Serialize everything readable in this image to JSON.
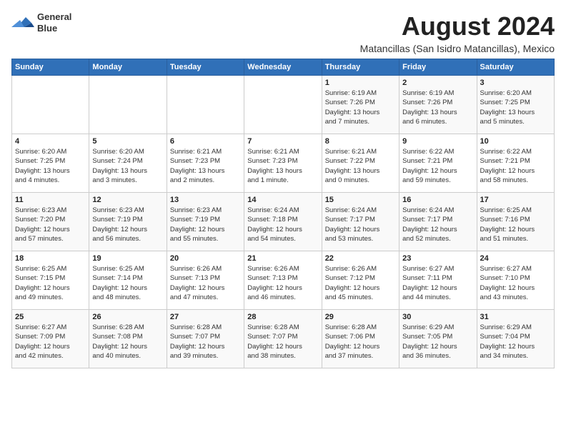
{
  "logo": {
    "line1": "General",
    "line2": "Blue"
  },
  "title": "August 2024",
  "subtitle": "Matancillas (San Isidro Matancillas), Mexico",
  "days_of_week": [
    "Sunday",
    "Monday",
    "Tuesday",
    "Wednesday",
    "Thursday",
    "Friday",
    "Saturday"
  ],
  "weeks": [
    [
      {
        "day": "",
        "info": ""
      },
      {
        "day": "",
        "info": ""
      },
      {
        "day": "",
        "info": ""
      },
      {
        "day": "",
        "info": ""
      },
      {
        "day": "1",
        "info": "Sunrise: 6:19 AM\nSunset: 7:26 PM\nDaylight: 13 hours\nand 7 minutes."
      },
      {
        "day": "2",
        "info": "Sunrise: 6:19 AM\nSunset: 7:26 PM\nDaylight: 13 hours\nand 6 minutes."
      },
      {
        "day": "3",
        "info": "Sunrise: 6:20 AM\nSunset: 7:25 PM\nDaylight: 13 hours\nand 5 minutes."
      }
    ],
    [
      {
        "day": "4",
        "info": "Sunrise: 6:20 AM\nSunset: 7:25 PM\nDaylight: 13 hours\nand 4 minutes."
      },
      {
        "day": "5",
        "info": "Sunrise: 6:20 AM\nSunset: 7:24 PM\nDaylight: 13 hours\nand 3 minutes."
      },
      {
        "day": "6",
        "info": "Sunrise: 6:21 AM\nSunset: 7:23 PM\nDaylight: 13 hours\nand 2 minutes."
      },
      {
        "day": "7",
        "info": "Sunrise: 6:21 AM\nSunset: 7:23 PM\nDaylight: 13 hours\nand 1 minute."
      },
      {
        "day": "8",
        "info": "Sunrise: 6:21 AM\nSunset: 7:22 PM\nDaylight: 13 hours\nand 0 minutes."
      },
      {
        "day": "9",
        "info": "Sunrise: 6:22 AM\nSunset: 7:21 PM\nDaylight: 12 hours\nand 59 minutes."
      },
      {
        "day": "10",
        "info": "Sunrise: 6:22 AM\nSunset: 7:21 PM\nDaylight: 12 hours\nand 58 minutes."
      }
    ],
    [
      {
        "day": "11",
        "info": "Sunrise: 6:23 AM\nSunset: 7:20 PM\nDaylight: 12 hours\nand 57 minutes."
      },
      {
        "day": "12",
        "info": "Sunrise: 6:23 AM\nSunset: 7:19 PM\nDaylight: 12 hours\nand 56 minutes."
      },
      {
        "day": "13",
        "info": "Sunrise: 6:23 AM\nSunset: 7:19 PM\nDaylight: 12 hours\nand 55 minutes."
      },
      {
        "day": "14",
        "info": "Sunrise: 6:24 AM\nSunset: 7:18 PM\nDaylight: 12 hours\nand 54 minutes."
      },
      {
        "day": "15",
        "info": "Sunrise: 6:24 AM\nSunset: 7:17 PM\nDaylight: 12 hours\nand 53 minutes."
      },
      {
        "day": "16",
        "info": "Sunrise: 6:24 AM\nSunset: 7:17 PM\nDaylight: 12 hours\nand 52 minutes."
      },
      {
        "day": "17",
        "info": "Sunrise: 6:25 AM\nSunset: 7:16 PM\nDaylight: 12 hours\nand 51 minutes."
      }
    ],
    [
      {
        "day": "18",
        "info": "Sunrise: 6:25 AM\nSunset: 7:15 PM\nDaylight: 12 hours\nand 49 minutes."
      },
      {
        "day": "19",
        "info": "Sunrise: 6:25 AM\nSunset: 7:14 PM\nDaylight: 12 hours\nand 48 minutes."
      },
      {
        "day": "20",
        "info": "Sunrise: 6:26 AM\nSunset: 7:13 PM\nDaylight: 12 hours\nand 47 minutes."
      },
      {
        "day": "21",
        "info": "Sunrise: 6:26 AM\nSunset: 7:13 PM\nDaylight: 12 hours\nand 46 minutes."
      },
      {
        "day": "22",
        "info": "Sunrise: 6:26 AM\nSunset: 7:12 PM\nDaylight: 12 hours\nand 45 minutes."
      },
      {
        "day": "23",
        "info": "Sunrise: 6:27 AM\nSunset: 7:11 PM\nDaylight: 12 hours\nand 44 minutes."
      },
      {
        "day": "24",
        "info": "Sunrise: 6:27 AM\nSunset: 7:10 PM\nDaylight: 12 hours\nand 43 minutes."
      }
    ],
    [
      {
        "day": "25",
        "info": "Sunrise: 6:27 AM\nSunset: 7:09 PM\nDaylight: 12 hours\nand 42 minutes."
      },
      {
        "day": "26",
        "info": "Sunrise: 6:28 AM\nSunset: 7:08 PM\nDaylight: 12 hours\nand 40 minutes."
      },
      {
        "day": "27",
        "info": "Sunrise: 6:28 AM\nSunset: 7:07 PM\nDaylight: 12 hours\nand 39 minutes."
      },
      {
        "day": "28",
        "info": "Sunrise: 6:28 AM\nSunset: 7:07 PM\nDaylight: 12 hours\nand 38 minutes."
      },
      {
        "day": "29",
        "info": "Sunrise: 6:28 AM\nSunset: 7:06 PM\nDaylight: 12 hours\nand 37 minutes."
      },
      {
        "day": "30",
        "info": "Sunrise: 6:29 AM\nSunset: 7:05 PM\nDaylight: 12 hours\nand 36 minutes."
      },
      {
        "day": "31",
        "info": "Sunrise: 6:29 AM\nSunset: 7:04 PM\nDaylight: 12 hours\nand 34 minutes."
      }
    ]
  ]
}
